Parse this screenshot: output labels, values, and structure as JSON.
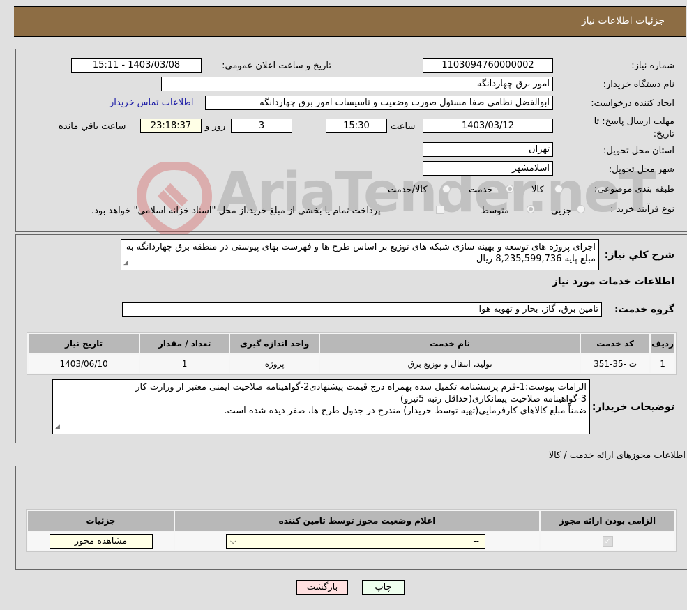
{
  "header": {
    "title": "جزئیات اطلاعات نیاز"
  },
  "details": {
    "need_number": {
      "label": "شماره نیاز:",
      "value": "1103094760000002"
    },
    "announce_datetime": {
      "label": "تاریخ و ساعت اعلان عمومی:",
      "value": "1403/03/08 - 15:11"
    },
    "buyer_org": {
      "label": "نام دستگاه خریدار:",
      "value": "امور برق چهاردانگه"
    },
    "requester": {
      "label": "ایجاد کننده درخواست:",
      "value": "ابوالفضل نظامی صفا مسئول صورت وضعیت و تاسیسات امور برق چهاردانگه"
    },
    "buyer_contact_link": "اطلاعات تماس خریدار",
    "deadline": {
      "label": "مهلت ارسال پاسخ: تا تاریخ:",
      "date": "1403/03/12",
      "time_label": "ساعت",
      "time": "15:30",
      "days": "3",
      "days_label": "روز و",
      "remaining": "23:18:37",
      "remaining_label": "ساعت باقي مانده"
    },
    "province": {
      "label": "استان محل تحویل:",
      "value": "تهران"
    },
    "city": {
      "label": "شهر محل تحویل:",
      "value": "اسلامشهر"
    },
    "category": {
      "label": "طبقه بندی موضوعی:",
      "options": [
        "کالا",
        "خدمت",
        "کالا/خدمت"
      ],
      "selected": "خدمت"
    },
    "purchase_type": {
      "label": "نوع فرآیند خرید :",
      "options": [
        "جزيي",
        "متوسط"
      ],
      "selected": "متوسط",
      "treasury_note": "پرداخت تمام یا بخشی از مبلغ خرید،از محل \"اسناد خزانه اسلامی\" خواهد بود.",
      "treasury_checked": false
    }
  },
  "description": {
    "label": "شرح کلي نیاز:",
    "text": "اجرای پروژه های توسعه و بهینه سازی شبکه های توزیع بر اساس طرح ها و فهرست بهای پیوستی در منطقه برق چهاردانگه به مبلغ پایه 8,235,599,736 ریال"
  },
  "services": {
    "section_title": "اطلاعات خدمات مورد نیاز",
    "group_label": "گروه خدمت:",
    "group_value": "تامین برق، گاز، بخار و تهویه هوا",
    "columns": [
      "ردیف",
      "کد خدمت",
      "نام خدمت",
      "واحد اندازه گیری",
      "تعداد / مقدار",
      "تاریخ نیاز"
    ],
    "rows": [
      {
        "row": "1",
        "code": "ت -35-351",
        "name": "تولید، انتقال و توزیع برق",
        "unit": "پروژه",
        "qty": "1",
        "date": "1403/06/10"
      }
    ]
  },
  "buyer_notes": {
    "label": "توضیحات خریدار:",
    "lines": [
      "الزامات پیوست:1-فرم پرسشنامه تکمیل شده بهمراه درج قیمت پیشنهادی2-گواهینامه صلاحیت ایمنی معتبر از وزارت کار",
      "3-گواهینامه صلاحیت پیمانکاری(حداقل رتبه 5نیرو)",
      "ضمناً مبلغ کالاهای کارفرمایی(تهیه توسط خریدار) مندرج در جدول طرح ها، صفر دیده شده است."
    ]
  },
  "permits": {
    "section_title": "اطلاعات مجوزهای ارائه خدمت / کالا",
    "columns": [
      "الزامی بودن ارائه مجوز",
      "اعلام وضعیت مجوز توسط تامین کننده",
      "جزئیات"
    ],
    "row": {
      "required_checked": true,
      "status_value": "--",
      "details_button": "مشاهده مجوز"
    }
  },
  "footer": {
    "back_button": "بازگشت",
    "print_button": "چاپ"
  },
  "watermark": {
    "text": "AriaTender.neT"
  },
  "colors": {
    "header_bg": "#8d6d44",
    "back_bg": "#ffe0e0",
    "print_bg": "#eeffee",
    "link": "#1a1aa6"
  }
}
